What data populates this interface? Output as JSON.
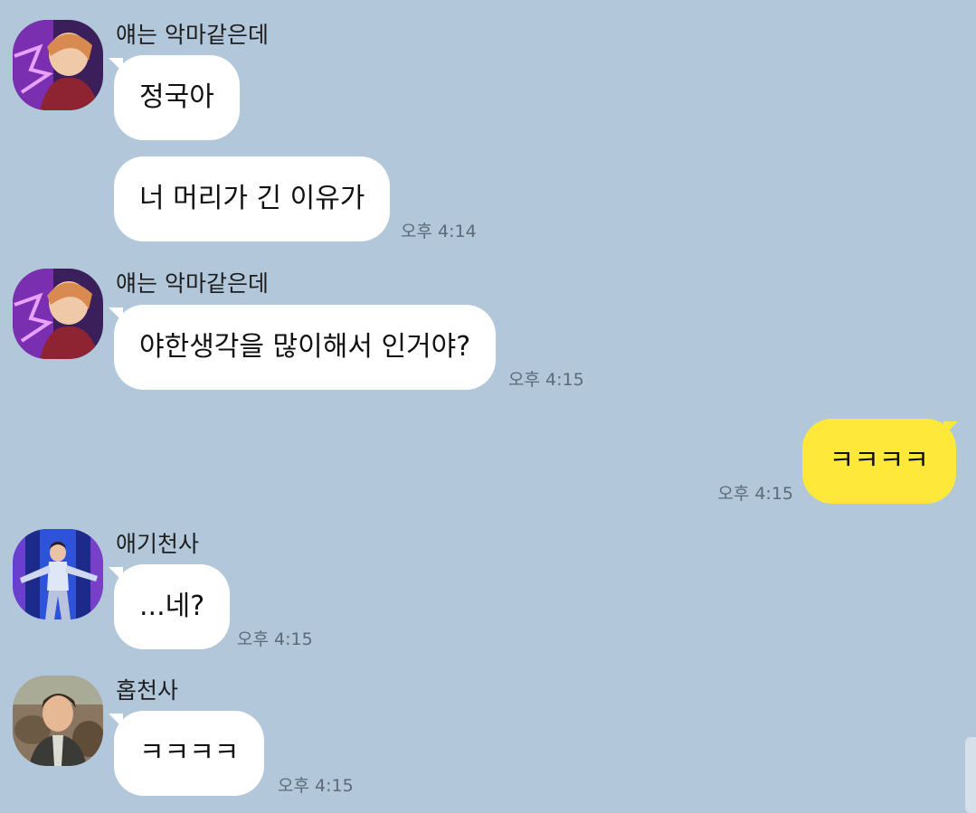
{
  "colors": {
    "background": "#b2c7da",
    "incoming_bubble": "#ffffff",
    "outgoing_bubble": "#fee93a"
  },
  "messages": [
    {
      "sender": "얘는 악마같은데",
      "avatar": "avatar-photo",
      "bubbles": [
        "정국아",
        "너 머리가 긴 이유가"
      ],
      "time": "오후 4:14"
    },
    {
      "sender": "얘는 악마같은데",
      "avatar": "avatar-photo",
      "bubbles": [
        "야한생각을 많이해서 인거야?"
      ],
      "time": "오후 4:15"
    },
    {
      "sender": "",
      "outgoing": true,
      "bubbles": [
        "ㅋㅋㅋㅋ"
      ],
      "time": "오후 4:15"
    },
    {
      "sender": "애기천사",
      "avatar": "avatar-photo",
      "bubbles": [
        "...네?"
      ],
      "time": "오후 4:15"
    },
    {
      "sender": "홉천사",
      "avatar": "avatar-photo",
      "bubbles": [
        "ㅋㅋㅋㅋ"
      ],
      "time": "오후 4:15"
    }
  ]
}
